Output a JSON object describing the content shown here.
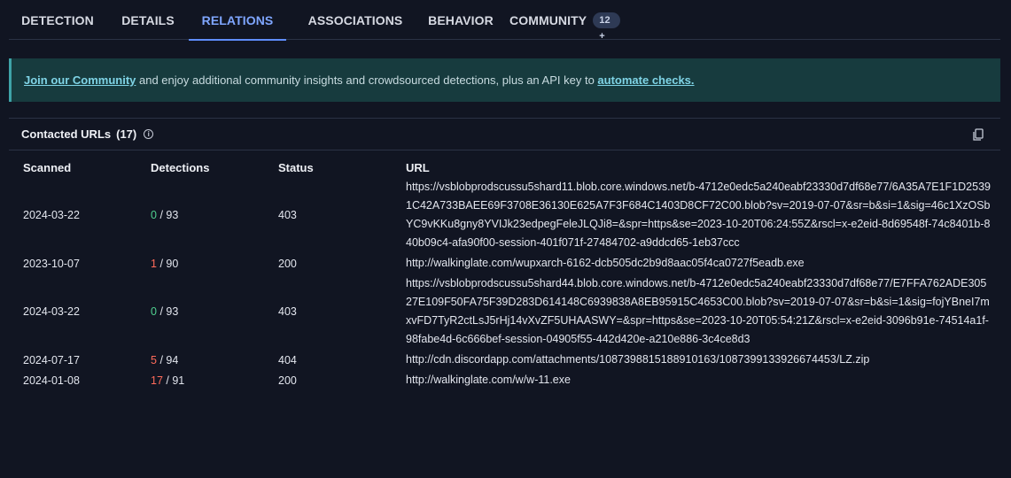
{
  "tabs": [
    {
      "label": "DETECTION"
    },
    {
      "label": "DETAILS"
    },
    {
      "label": "RELATIONS"
    },
    {
      "label": "ASSOCIATIONS"
    },
    {
      "label": "BEHAVIOR"
    },
    {
      "label": "COMMUNITY",
      "badge": "12 +"
    }
  ],
  "banner": {
    "link1": "Join our Community",
    "text": " and enjoy additional community insights and crowdsourced detections, plus an API key to ",
    "link2": "automate checks."
  },
  "panel": {
    "title": "Contacted URLs",
    "count": "(17)"
  },
  "table": {
    "headers": [
      "Scanned",
      "Detections",
      "Status",
      "URL"
    ],
    "rows": [
      {
        "scanned": "2024-03-22",
        "det": "0",
        "total": "/ 93",
        "status": "403",
        "url": "https://vsblobprodscussu5shard11.blob.core.windows.net/b-4712e0edc5a240eabf23330d7df68e77/6A35A7E1F1D25391C42A733BAEE69F3708E36130E625A7F3F684C1403D8CF72C00.blob?sv=2019-07-07&sr=b&si=1&sig=46c1XzOSbYC9vKKu8gny8YVIJk23edpegFeleJLQJi8=&spr=https&se=2023-10-20T06:24:55Z&rscl=x-e2eid-8d69548f-74c8401b-840b09c4-afa90f00-session-401f071f-27484702-a9ddcd65-1eb37ccc"
      },
      {
        "scanned": "2023-10-07",
        "det": "1",
        "total": "/ 90",
        "status": "200",
        "url": "http://walkinglate.com/wupxarch-6162-dcb505dc2b9d8aac05f4ca0727f5eadb.exe"
      },
      {
        "scanned": "2024-03-22",
        "det": "0",
        "total": "/ 93",
        "status": "403",
        "url": "https://vsblobprodscussu5shard44.blob.core.windows.net/b-4712e0edc5a240eabf23330d7df68e77/E7FFA762ADE30527E109F50FA75F39D283D614148C6939838A8EB95915C4653C00.blob?sv=2019-07-07&sr=b&si=1&sig=fojYBneI7mxvFD7TyR2ctLsJ5rHj14vXvZF5UHAASWY=&spr=https&se=2023-10-20T05:54:21Z&rscl=x-e2eid-3096b91e-74514a1f-98fabe4d-6c666bef-session-04905f55-442d420e-a210e886-3c4ce8d3"
      },
      {
        "scanned": "2024-07-17",
        "det": "5",
        "total": "/ 94",
        "status": "404",
        "url": "http://cdn.discordapp.com/attachments/1087398815188910163/1087399133926674453/LZ.zip"
      },
      {
        "scanned": "2024-01-08",
        "det": "17",
        "total": "/ 91",
        "status": "200",
        "url": "http://walkinglate.com/w/w-11.exe"
      }
    ]
  }
}
